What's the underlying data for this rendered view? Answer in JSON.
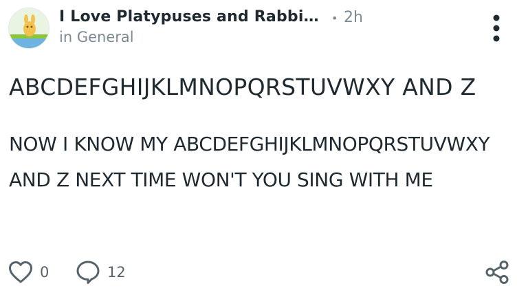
{
  "header": {
    "community_name": "I Love Platypuses and Rabbi...",
    "separator": "•",
    "time_ago": "2h",
    "channel": "in General"
  },
  "post": {
    "title": "ABCDEFGHIJKLMNOPQRSTUVWXY AND Z",
    "body": "NOW I KNOW MY ABCDEFGHIJKLMNOPQRSTUVWXY AND Z NEXT TIME WON'T YOU SING WITH ME"
  },
  "actions": {
    "like_count": "0",
    "comment_count": "12"
  },
  "icons": {
    "avatar": "community-avatar",
    "more": "more-vertical-icon",
    "like": "heart-icon",
    "comment": "comment-bubble-icon",
    "share": "share-icon"
  },
  "colors": {
    "text": "#1f2a30",
    "muted": "#7b8a94"
  }
}
